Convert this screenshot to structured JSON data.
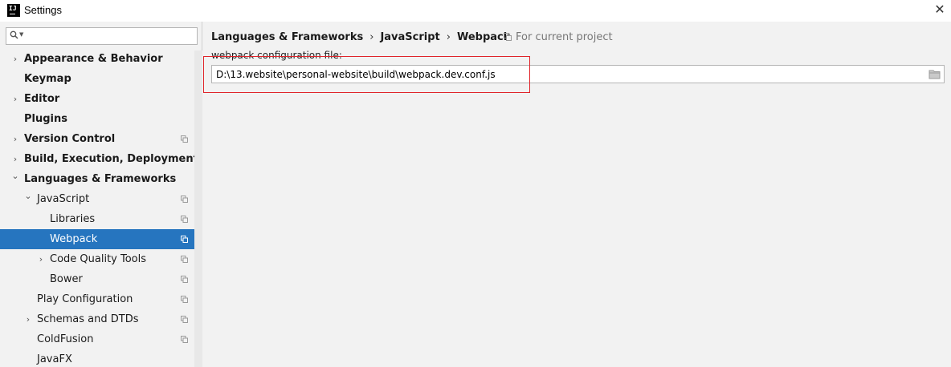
{
  "window": {
    "title": "Settings",
    "app_icon_text": "IJ",
    "close_glyph": "✕"
  },
  "search": {
    "value": "",
    "placeholder": ""
  },
  "sidebar": {
    "items": [
      {
        "label": "Appearance & Behavior",
        "bold": true,
        "chevron": "›",
        "level": 0
      },
      {
        "label": "Keymap",
        "bold": true,
        "chevron": "",
        "level": 0
      },
      {
        "label": "Editor",
        "bold": true,
        "chevron": "›",
        "level": 0
      },
      {
        "label": "Plugins",
        "bold": true,
        "chevron": "",
        "level": 0
      },
      {
        "label": "Version Control",
        "bold": true,
        "chevron": "›",
        "level": 0,
        "copy": true
      },
      {
        "label": "Build, Execution, Deployment",
        "bold": true,
        "chevron": "›",
        "level": 0
      },
      {
        "label": "Languages & Frameworks",
        "bold": true,
        "chevron": "⌄",
        "level": 0
      },
      {
        "label": "JavaScript",
        "bold": false,
        "chevron": "⌄",
        "level": 1,
        "copy": true
      },
      {
        "label": "Libraries",
        "bold": false,
        "chevron": "",
        "level": 2,
        "copy": true
      },
      {
        "label": "Webpack",
        "bold": false,
        "chevron": "",
        "level": 2,
        "copy": true,
        "selected": true
      },
      {
        "label": "Code Quality Tools",
        "bold": false,
        "chevron": "›",
        "level": 2,
        "copy": true
      },
      {
        "label": "Bower",
        "bold": false,
        "chevron": "",
        "level": 2,
        "copy": true
      },
      {
        "label": "Play Configuration",
        "bold": false,
        "chevron": "",
        "level": 1,
        "copy": true
      },
      {
        "label": "Schemas and DTDs",
        "bold": false,
        "chevron": "›",
        "level": 1,
        "copy": true
      },
      {
        "label": "ColdFusion",
        "bold": false,
        "chevron": "",
        "level": 1,
        "copy": true
      },
      {
        "label": "JavaFX",
        "bold": false,
        "chevron": "",
        "level": 1
      }
    ]
  },
  "breadcrumb": {
    "items": [
      "Languages & Frameworks",
      "JavaScript",
      "Webpack"
    ],
    "separator": "›"
  },
  "scope": {
    "label": "For current project"
  },
  "webpack": {
    "field_label": "webpack configuration file:",
    "path_value": "D:\\13.website\\personal-website\\build\\webpack.dev.conf.js"
  },
  "colors": {
    "selection": "#2675bf",
    "highlight_border": "#e0242a",
    "background": "#f2f2f2"
  }
}
